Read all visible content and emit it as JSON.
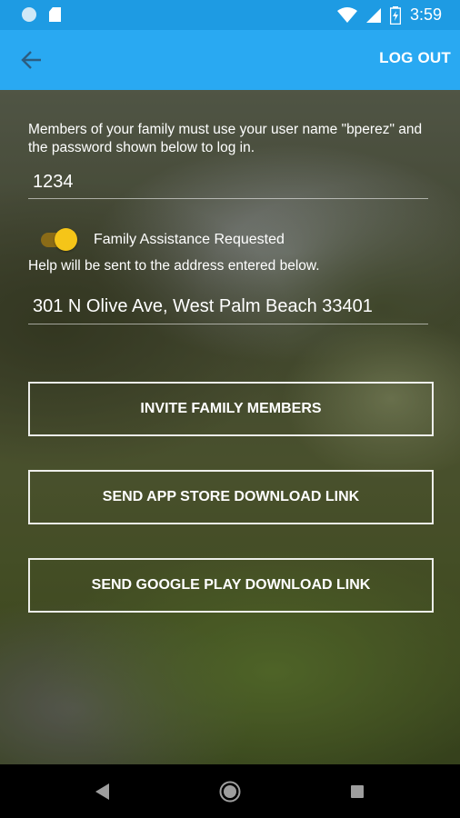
{
  "status_bar": {
    "time": "3:59",
    "icons": [
      "circle-icon",
      "sd-card-icon",
      "wifi-icon",
      "signal-icon",
      "battery-charging-icon"
    ]
  },
  "app_bar": {
    "back_icon": "arrow-left-icon",
    "logout_label": "LOG OUT",
    "background_color": "#29a9f2"
  },
  "main": {
    "members_text": "Members of your family must use your user name \"bperez\" and the password shown below to log in.",
    "password_value": "1234",
    "toggle": {
      "label": "Family Assistance Requested",
      "on": true,
      "thumb_color": "#f5c518"
    },
    "help_text": "Help will be sent to the address entered below.",
    "address_value": "301 N Olive Ave, West Palm Beach 33401",
    "buttons": {
      "invite": "INVITE FAMILY MEMBERS",
      "app_store": "SEND APP STORE DOWNLOAD LINK",
      "google_play": "SEND GOOGLE PLAY DOWNLOAD LINK"
    }
  },
  "nav_bar": {
    "icons": [
      "nav-back-icon",
      "nav-home-icon",
      "nav-recents-icon"
    ]
  }
}
